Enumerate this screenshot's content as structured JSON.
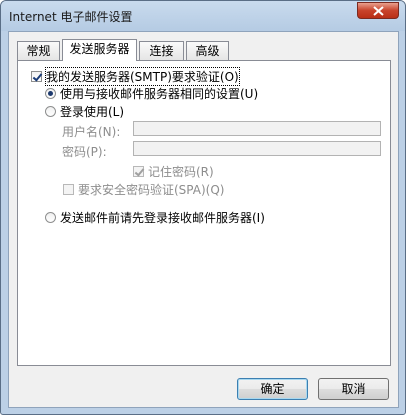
{
  "window": {
    "title": "Internet 电子邮件设置"
  },
  "tabs": [
    {
      "label": "常规",
      "active": false
    },
    {
      "label": "发送服务器",
      "active": true
    },
    {
      "label": "连接",
      "active": false
    },
    {
      "label": "高级",
      "active": false
    }
  ],
  "outgoing": {
    "smtp_auth": {
      "label": "我的发送服务器(SMTP)要求验证(O)",
      "checked": true
    },
    "same_as_incoming": {
      "label": "使用与接收邮件服务器相同的设置(U)",
      "selected": true
    },
    "log_on_using": {
      "label": "登录使用(L)",
      "selected": false
    },
    "username": {
      "label": "用户名(N):",
      "value": ""
    },
    "password": {
      "label": "密码(P):",
      "value": ""
    },
    "remember_password": {
      "label": "记住密码(R)",
      "checked": true
    },
    "require_spa": {
      "label": "要求安全密码验证(SPA)(Q)",
      "checked": false
    },
    "log_on_incoming_first": {
      "label": "发送邮件前请先登录接收邮件服务器(I)",
      "selected": false
    }
  },
  "buttons": {
    "ok": "确定",
    "cancel": "取消"
  }
}
